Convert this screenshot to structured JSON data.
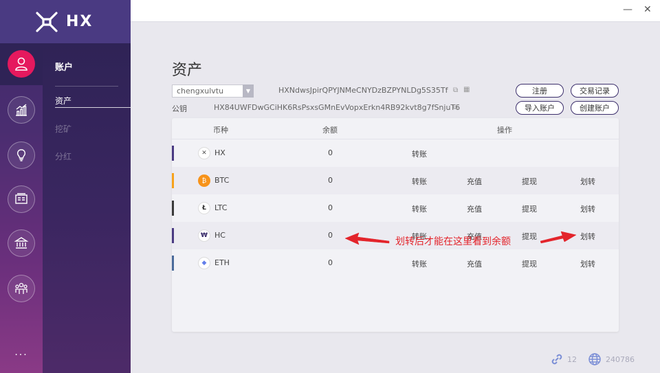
{
  "app": {
    "name": "HX"
  },
  "sidebar_rail": {
    "items": [
      "user-icon",
      "chart-icon",
      "bulb-icon",
      "id-card-icon",
      "bank-icon",
      "group-icon"
    ],
    "more_label": "..."
  },
  "subnav": {
    "title": "账户",
    "items": [
      {
        "label": "资产",
        "active": true
      },
      {
        "label": "挖矿",
        "active": false
      },
      {
        "label": "分红",
        "active": false
      }
    ]
  },
  "window": {
    "minimize": "—",
    "close": "✕"
  },
  "page": {
    "title": "资产",
    "account_select": {
      "value": "chengxulvtu"
    },
    "address": "HXNdwsJpirQPYJNMeCNYDzBZPYNLDg5S35Tf",
    "pubkey_label": "公钥",
    "pubkey": "HX84UWFDwGCiHK6RsPsxsGMnEvVopxErkn4RB92kvt8g7fSnjuT6",
    "buttons": {
      "register": "注册",
      "tx_history": "交易记录",
      "import_account": "导入账户",
      "create_account": "创建账户"
    }
  },
  "table": {
    "headers": {
      "coin": "币种",
      "balance": "余额",
      "actions": "操作"
    },
    "rows": [
      {
        "coin": "HX",
        "balance": "0",
        "bar_color": "#4a3a82",
        "icon": "hx-coin-icon",
        "actions": [
          "转账"
        ]
      },
      {
        "coin": "BTC",
        "balance": "0",
        "bar_color": "#f7a21b",
        "icon": "btc-coin-icon",
        "actions": [
          "转账",
          "充值",
          "提现",
          "划转"
        ]
      },
      {
        "coin": "LTC",
        "balance": "0",
        "bar_color": "#3a3a3a",
        "icon": "ltc-coin-icon",
        "actions": [
          "转账",
          "充值",
          "提现",
          "划转"
        ]
      },
      {
        "coin": "HC",
        "balance": "0",
        "bar_color": "#4a3a82",
        "icon": "hc-coin-icon",
        "actions": [
          "转账",
          "充值",
          "提现",
          "划转"
        ]
      },
      {
        "coin": "ETH",
        "balance": "0",
        "bar_color": "#4a6a9a",
        "icon": "eth-coin-icon",
        "actions": [
          "转账",
          "充值",
          "提现",
          "划转"
        ]
      }
    ]
  },
  "annotation": {
    "text": "划转后才能在这里看到余额",
    "color": "#e3242b"
  },
  "status": {
    "connections": "12",
    "block_height": "240786"
  }
}
